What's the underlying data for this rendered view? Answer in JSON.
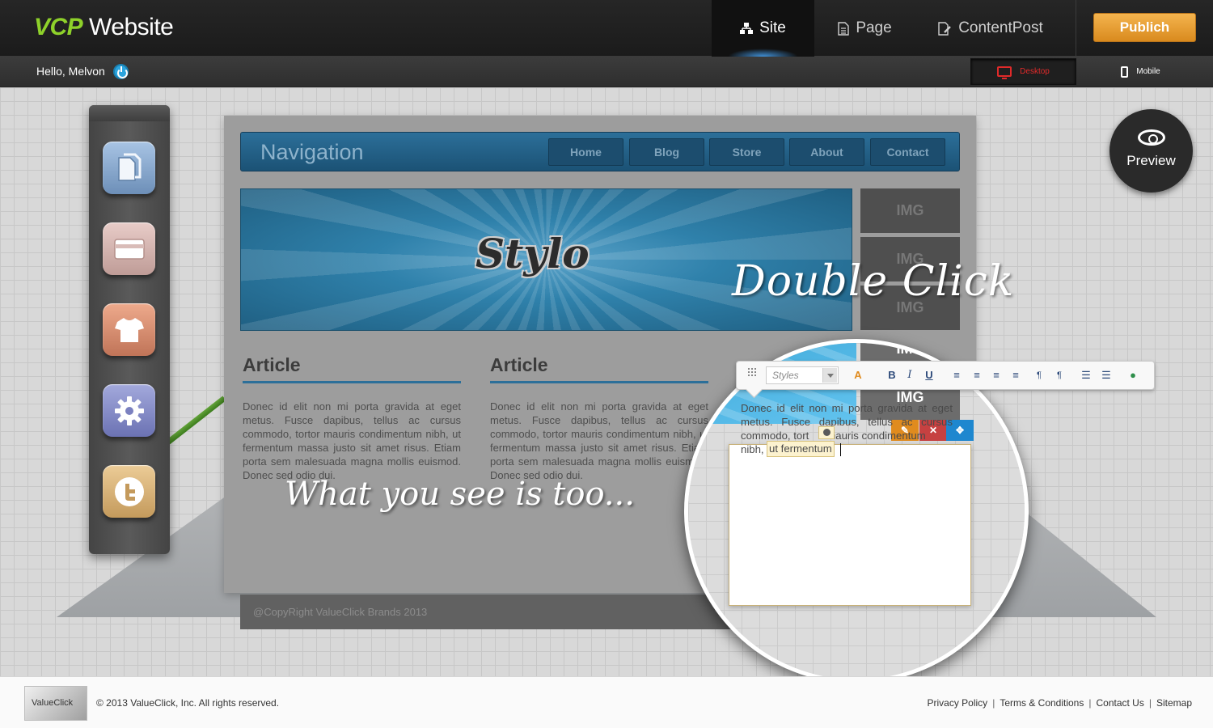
{
  "app": {
    "logo_bold": "VCP",
    "logo_rest": " Website"
  },
  "top_nav": {
    "site": "Site",
    "page": "Page",
    "contentpost": "ContentPost",
    "publish": "Publich"
  },
  "sub_bar": {
    "greeting": "Hello, Melvon",
    "desktop": "Desktop",
    "mobile": "Mobile"
  },
  "tools": [
    "pages-icon",
    "layout-icon",
    "theme-icon",
    "settings-icon",
    "twitter-icon"
  ],
  "canvas": {
    "nav_title": "Navigation",
    "nav_links": [
      "Home",
      "Blog",
      "Store",
      "About",
      "Contact"
    ],
    "banner_logo": "Stylo",
    "img_label": "IMG",
    "article_title": "Article",
    "article_text": "Donec id elit non mi porta gravida at eget metus. Fusce dapibus, tellus ac cursus commodo, tortor mauris condimentum nibh, ut fermentum massa justo sit amet risus. Etiam porta sem malesuada magna mollis euismod. Donec sed odio dui.",
    "footer": "@CopyRight ValueClick Brands 2013"
  },
  "overlay": {
    "double_click": "Double Click",
    "what_you_see": "What you see is too..."
  },
  "editor": {
    "styles_placeholder": "Styles",
    "text_part1": "Donec id elit non mi porta gravida at eget metus. Fusce dapibus, tellus ac cursus commodo, tort",
    "text_part2": "mauris condimentum",
    "text_part3": "nibh,",
    "highlight": "ut fermentum",
    "toolbar": [
      "B",
      "I",
      "U"
    ]
  },
  "preview": {
    "label": "Preview"
  },
  "footer": {
    "logo": "ValueClick",
    "copyright": "© 2013 ValueClick, Inc. All rights reserved.",
    "links": [
      "Privacy Policy",
      "Terms & Conditions",
      "Contact Us",
      "Sitemap"
    ]
  }
}
